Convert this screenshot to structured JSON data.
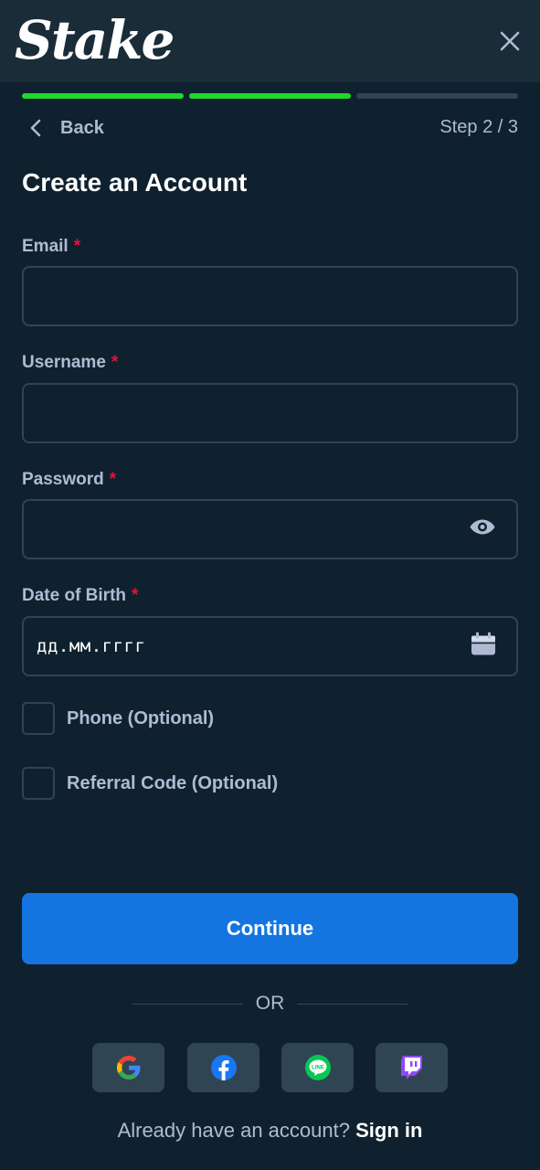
{
  "header": {
    "logo_text": "Stake"
  },
  "progress": {
    "current_step": 2,
    "total_steps": 3,
    "active_color": "#1fd82c",
    "inactive_color": "#2f4553"
  },
  "nav": {
    "back_label": "Back",
    "step_text": "Step 2 / 3"
  },
  "form": {
    "title": "Create an Account",
    "required_marker": "*",
    "email": {
      "label": "Email",
      "value": ""
    },
    "username": {
      "label": "Username",
      "value": ""
    },
    "password": {
      "label": "Password",
      "value": ""
    },
    "dob": {
      "label": "Date of Birth",
      "value": "дд.мм.гггг"
    },
    "phone_option": {
      "label": "Phone (Optional)",
      "checked": false
    },
    "referral_option": {
      "label": "Referral Code (Optional)",
      "checked": false
    }
  },
  "actions": {
    "continue_label": "Continue",
    "divider_text": "OR"
  },
  "social": [
    {
      "icon": "google-icon"
    },
    {
      "icon": "facebook-icon"
    },
    {
      "icon": "line-icon"
    },
    {
      "icon": "twitch-icon"
    }
  ],
  "footer": {
    "prompt": "Already have an account?",
    "signin_label": "Sign in"
  },
  "colors": {
    "background": "#0f212e",
    "header": "#1a2c38",
    "accent_blue": "#1475e1",
    "required_red": "#e9113c",
    "muted_text": "#b1bad3"
  }
}
